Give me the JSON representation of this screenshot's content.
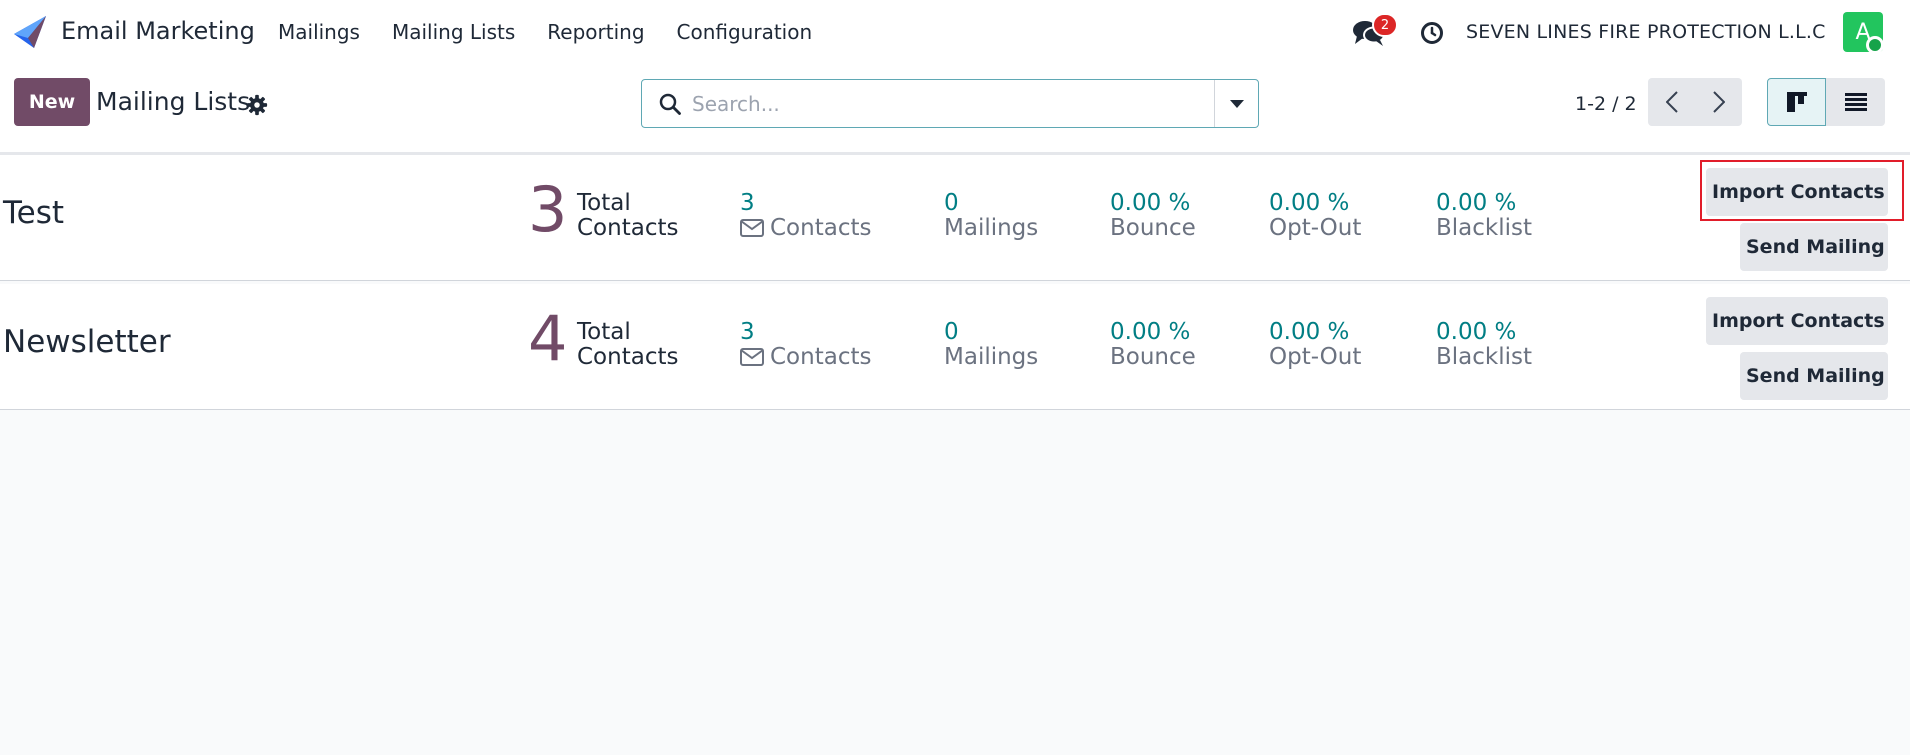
{
  "app": {
    "name": "Email Marketing",
    "brand_color": "#714b67",
    "accent_color": "#017e84"
  },
  "navbar": {
    "menu": [
      {
        "label": "Mailings"
      },
      {
        "label": "Mailing Lists"
      },
      {
        "label": "Reporting"
      },
      {
        "label": "Configuration"
      }
    ],
    "messages_icon": "chat-bubbles-icon",
    "messages_badge": "2",
    "activity_icon": "clock-icon",
    "company": "SEVEN LINES FIRE PROTECTION L.L.C",
    "avatar_initial": "A",
    "avatar_color": "#22c55e"
  },
  "control_panel": {
    "new_label": "New",
    "title": "Mailing Lists",
    "settings_icon": "gear-icon",
    "search_placeholder": "Search...",
    "search_value": "",
    "pager": "1-2 / 2",
    "views": [
      "kanban",
      "list"
    ],
    "active_view": "kanban"
  },
  "records": [
    {
      "name": "Test",
      "total": "3",
      "total_label_1": "Total",
      "total_label_2": "Contacts",
      "contacts_value": "3",
      "contacts_label": "Contacts",
      "mailings_value": "0",
      "mailings_label": "Mailings",
      "bounce_value": "0.00 %",
      "bounce_label": "Bounce",
      "optout_value": "0.00 %",
      "optout_label": "Opt-Out",
      "blacklist_value": "0.00 %",
      "blacklist_label": "Blacklist",
      "import_label": "Import Contacts",
      "send_label": "Send Mailing"
    },
    {
      "name": "Newsletter",
      "total": "4",
      "total_label_1": "Total",
      "total_label_2": "Contacts",
      "contacts_value": "3",
      "contacts_label": "Contacts",
      "mailings_value": "0",
      "mailings_label": "Mailings",
      "bounce_value": "0.00 %",
      "bounce_label": "Bounce",
      "optout_value": "0.00 %",
      "optout_label": "Opt-Out",
      "blacklist_value": "0.00 %",
      "blacklist_label": "Blacklist",
      "import_label": "Import Contacts",
      "send_label": "Send Mailing"
    }
  ],
  "highlight_color": "#e11d2a"
}
